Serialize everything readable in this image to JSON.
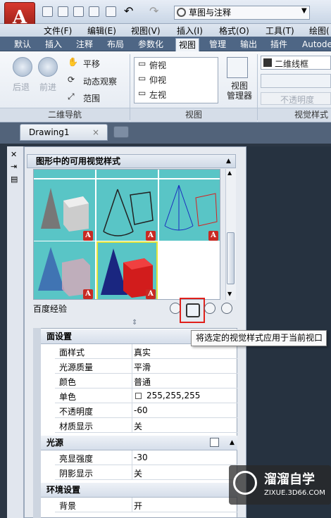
{
  "app": {
    "logo_letter": "A",
    "workspace": "草图与注释",
    "title_cut": "Autode"
  },
  "menu": [
    "文件(F)",
    "编辑(E)",
    "视图(V)",
    "插入(I)",
    "格式(O)",
    "工具(T)",
    "绘图("
  ],
  "ribbon_tabs": [
    "默认",
    "插入",
    "注释",
    "布局",
    "参数化",
    "视图",
    "管理",
    "输出",
    "插件",
    "Autode"
  ],
  "active_tab": "视图",
  "nav": {
    "back": "后退",
    "forward": "前进",
    "pan": "平移",
    "orbit": "动态观察",
    "extents": "范围",
    "group": "二维导航"
  },
  "views": {
    "items": [
      "俯视",
      "仰视",
      "左视"
    ],
    "manager": "视图\n管理器",
    "group": "视图"
  },
  "visual": {
    "style": "二维线框",
    "opacity": "不透明度",
    "group": "视觉样式"
  },
  "doc_tab": {
    "name": "Drawing1",
    "close": "×"
  },
  "palette": {
    "title": "图形中的可用视觉样式",
    "status": "百度经验",
    "tooltip": "将选定的视觉样式应用于当前视口"
  },
  "sections": [
    {
      "name": "面设置",
      "rows": [
        [
          "面样式",
          "真实"
        ],
        [
          "光源质量",
          "平滑"
        ],
        [
          "颜色",
          "普通"
        ],
        [
          "单色",
          "255,255,255"
        ],
        [
          "不透明度",
          "-60"
        ],
        [
          "材质显示",
          "关"
        ]
      ]
    },
    {
      "name": "光源",
      "rows": [
        [
          "亮显强度",
          "-30"
        ],
        [
          "阴影显示",
          "关"
        ]
      ]
    },
    {
      "name": "环境设置",
      "rows": [
        [
          "背景",
          "开"
        ]
      ]
    }
  ],
  "watermark": {
    "name": "溜溜自学",
    "url": "ZIXUE.3D66.COM"
  },
  "colors": {
    "accent": "#e0201b",
    "thumb_bg": "#59c5c6",
    "tab_bar": "#4e6685"
  }
}
